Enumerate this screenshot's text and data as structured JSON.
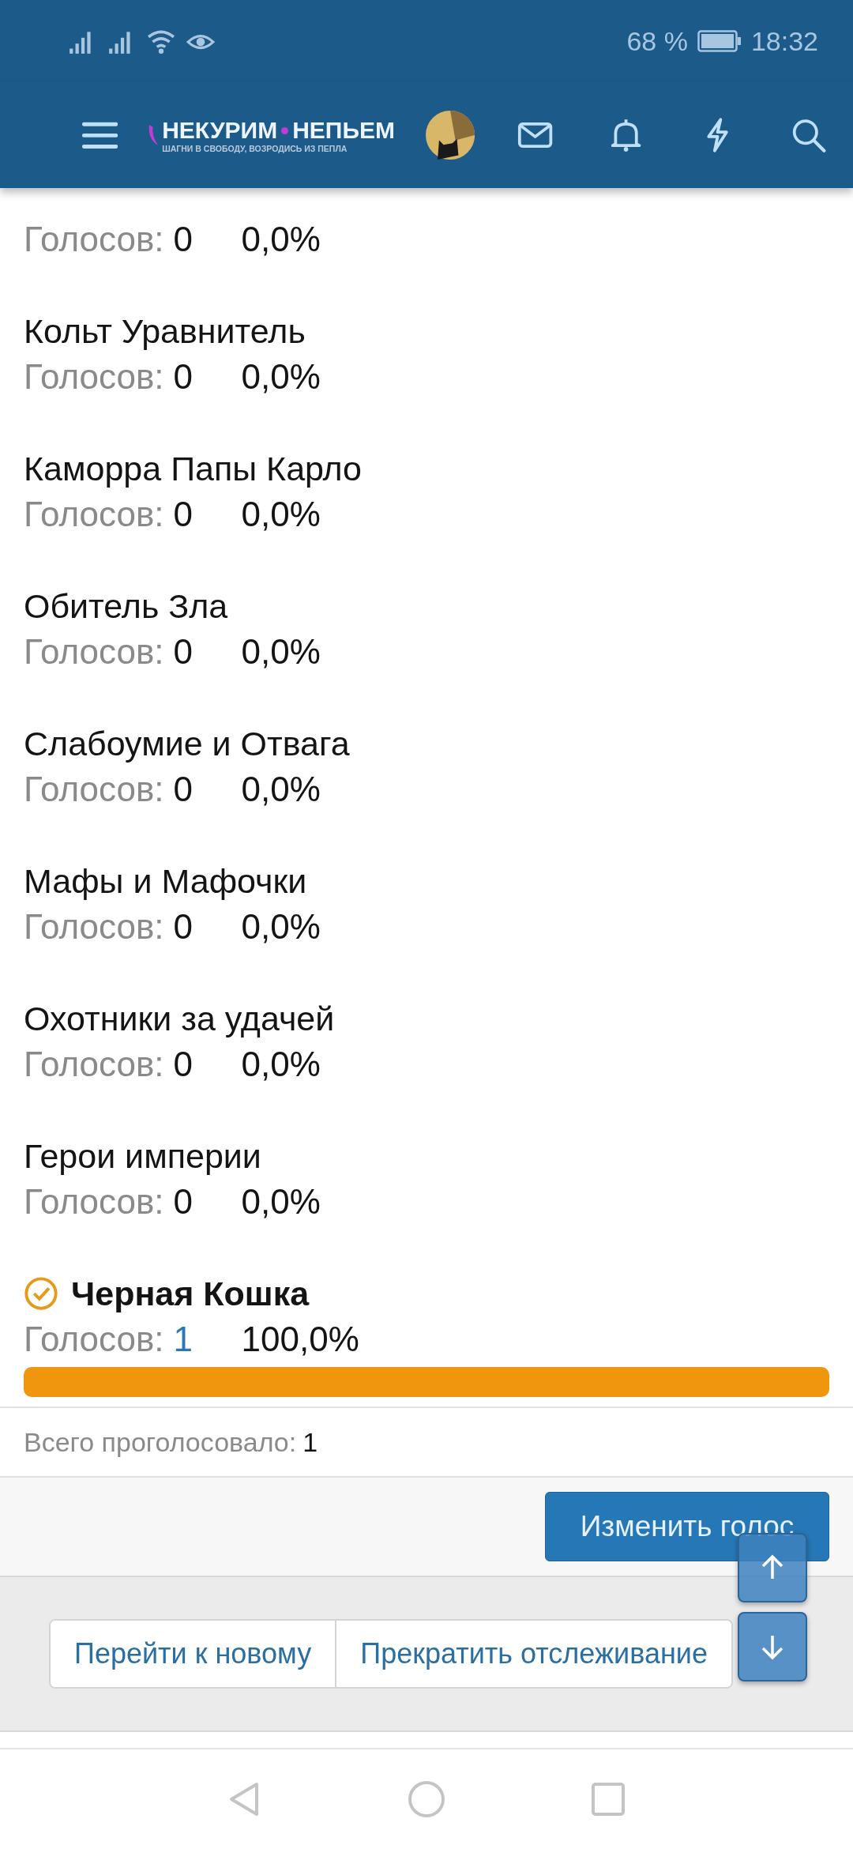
{
  "status_bar": {
    "battery": "68 %",
    "time": "18:32"
  },
  "header": {
    "logo_title": "НЕКУРИМ",
    "logo_title_2": "НЕПЬЕМ",
    "logo_tagline": "ШАГНИ В СВОБОДУ, ВОЗРОДИСЬ ИЗ ПЕПЛА"
  },
  "poll": {
    "options": [
      {
        "votes_label": "Голосов:",
        "votes": "0",
        "percent": "0,0%",
        "voted": false
      },
      {
        "name": "Кольт Уравнитель",
        "votes_label": "Голосов:",
        "votes": "0",
        "percent": "0,0%",
        "voted": false
      },
      {
        "name": "Каморра Папы Карло",
        "votes_label": "Голосов:",
        "votes": "0",
        "percent": "0,0%",
        "voted": false
      },
      {
        "name": "Обитель Зла",
        "votes_label": "Голосов:",
        "votes": "0",
        "percent": "0,0%",
        "voted": false
      },
      {
        "name": "Слабоумие и Отвага",
        "votes_label": "Голосов:",
        "votes": "0",
        "percent": "0,0%",
        "voted": false
      },
      {
        "name": "Мафы и Мафочки",
        "votes_label": "Голосов:",
        "votes": "0",
        "percent": "0,0%",
        "voted": false
      },
      {
        "name": "Охотники за удачей",
        "votes_label": "Голосов:",
        "votes": "0",
        "percent": "0,0%",
        "voted": false
      },
      {
        "name": "Герои империи",
        "votes_label": "Голосов:",
        "votes": "0",
        "percent": "0,0%",
        "voted": false
      },
      {
        "name": "Черная Кошка",
        "votes_label": "Голосов:",
        "votes": "1",
        "percent": "100,0%",
        "voted": true
      }
    ],
    "total_label": "Всего проголосовало:",
    "total": "1",
    "change_vote_button": "Изменить голос"
  },
  "thread_actions": [
    "Перейти к новому",
    "Прекратить отслеживание"
  ]
}
